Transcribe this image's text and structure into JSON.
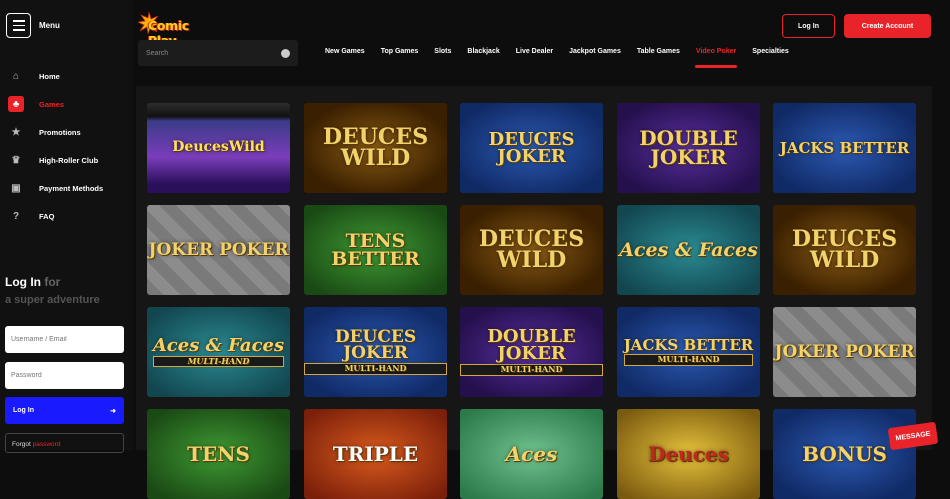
{
  "sidebar": {
    "menu_label": "Menu",
    "items": [
      {
        "label": "Home",
        "icon": "home-icon",
        "glyph": "⌂"
      },
      {
        "label": "Games",
        "icon": "games-icon",
        "glyph": "♣"
      },
      {
        "label": "Promotions",
        "icon": "star-icon",
        "glyph": "★"
      },
      {
        "label": "High-Roller Club",
        "icon": "crown-icon",
        "glyph": "♛"
      },
      {
        "label": "Payment Methods",
        "icon": "wallet-icon",
        "glyph": "▣"
      },
      {
        "label": "FAQ",
        "icon": "question-icon",
        "glyph": "?"
      }
    ],
    "login": {
      "title": "Log In",
      "title_suffix": "for",
      "subtitle": "a super adventure",
      "username_placeholder": "Username / Email",
      "password_placeholder": "Password",
      "button_label": "Log In",
      "forgot_prefix": "Forgot",
      "forgot_link": "password"
    }
  },
  "header": {
    "logo_text": "Comic Play",
    "login_label": "Log In",
    "create_account_label": "Create Account",
    "search_placeholder": "Search"
  },
  "categories": [
    "New Games",
    "Top Games",
    "Slots",
    "Blackjack",
    "Live Dealer",
    "Jackpot Games",
    "Table Games",
    "Video Poker",
    "Specialties"
  ],
  "active_category": "Video Poker",
  "games": [
    {
      "title": "DeucesWild",
      "sub": "",
      "theme": "machine"
    },
    {
      "title": "DEUCES WILD",
      "sub": "",
      "theme": "brown"
    },
    {
      "title": "DEUCES JOKER",
      "sub": "",
      "theme": "blue"
    },
    {
      "title": "DOUBLE JOKER",
      "sub": "",
      "theme": "purple"
    },
    {
      "title": "JACKS BETTER",
      "sub": "",
      "theme": "blue"
    },
    {
      "title": "JOKER POKER",
      "sub": "",
      "theme": "grey"
    },
    {
      "title": "TENS BETTER",
      "sub": "",
      "theme": "green"
    },
    {
      "title": "DEUCES WILD",
      "sub": "",
      "theme": "brown"
    },
    {
      "title": "Aces & Faces",
      "sub": "",
      "theme": "teal"
    },
    {
      "title": "DEUCES WILD",
      "sub": "",
      "theme": "brown"
    },
    {
      "title": "Aces & Faces",
      "sub": "MULTI-HAND",
      "theme": "teal"
    },
    {
      "title": "DEUCES JOKER",
      "sub": "MULTI-HAND",
      "theme": "blue"
    },
    {
      "title": "DOUBLE JOKER",
      "sub": "MULTI-HAND",
      "theme": "purple"
    },
    {
      "title": "JACKS BETTER",
      "sub": "MULTI-HAND",
      "theme": "blue"
    },
    {
      "title": "JOKER POKER",
      "sub": "",
      "theme": "grey"
    },
    {
      "title": "TENS",
      "sub": "",
      "theme": "green"
    },
    {
      "title": "TRIPLE",
      "sub": "",
      "theme": "orange"
    },
    {
      "title": "Aces",
      "sub": "",
      "theme": "felt"
    },
    {
      "title": "Deuces",
      "sub": "",
      "theme": "yellow"
    },
    {
      "title": "BONUS",
      "sub": "",
      "theme": "blue"
    }
  ],
  "message_button": "MESSAGE",
  "colors": {
    "accent": "#e8232a",
    "login_button": "#1a1aff",
    "logo": "#ffd21a"
  }
}
